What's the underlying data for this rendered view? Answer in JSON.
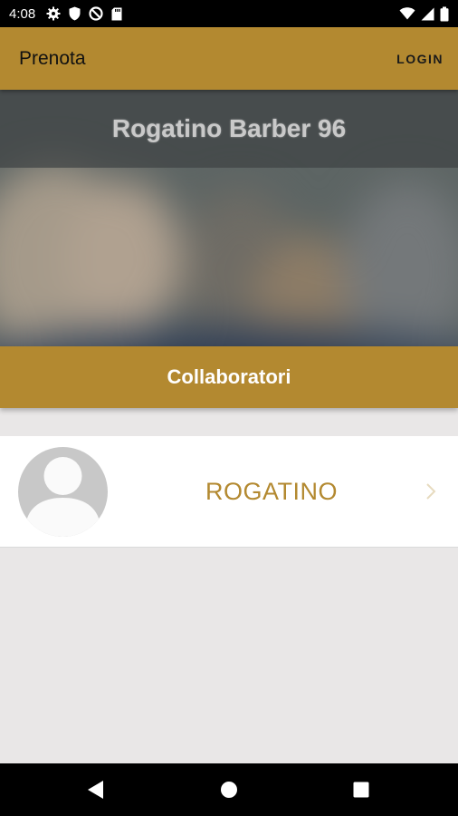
{
  "status_bar": {
    "time": "4:08",
    "left_icons": [
      "gear-icon",
      "shield-icon",
      "do-not-disturb-icon",
      "sd-card-icon"
    ],
    "right_icons": [
      "wifi-icon",
      "signal-icon",
      "battery-icon"
    ]
  },
  "app_bar": {
    "title": "Prenota",
    "login_label": "LOGIN",
    "color": "#b38930"
  },
  "hero": {
    "shop_name": "Rogatino Barber 96"
  },
  "section": {
    "title": "Collaboratori"
  },
  "staff": [
    {
      "name": "ROGATINO",
      "avatar": "default-person-avatar"
    }
  ],
  "nav_bar": {
    "icons": [
      "back-icon",
      "home-icon",
      "recents-icon"
    ]
  }
}
